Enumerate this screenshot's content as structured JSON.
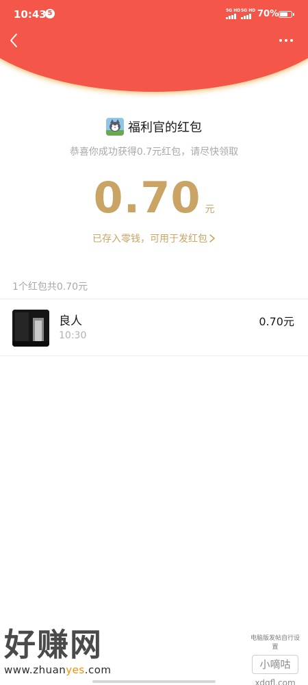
{
  "status_bar": {
    "time": "10:43",
    "app_badge": "5",
    "network_1": "5G HD",
    "network_2": "5G HD",
    "battery_text": "70%",
    "battery_level": 0.7
  },
  "nav": {
    "back_icon": "chevron-left-icon",
    "more_icon": "more-dots-icon"
  },
  "sender": {
    "name": "福利官的红包",
    "avatar_icon": "cartoon-cat-avatar"
  },
  "subtitle": "恭喜你成功获得0.7元红包，请尽快领取",
  "amount": {
    "value": "0.70",
    "unit": "元"
  },
  "saved_link": "已存入零钱，可用于发红包",
  "summary": "1个红包共0.70元",
  "records": [
    {
      "name": "良人",
      "time": "10:30",
      "amount": "0.70元"
    }
  ],
  "watermark_left": {
    "title": "好赚网",
    "url_prefix": "www.zhuan",
    "url_highlight": "yes",
    "url_suffix": ".com"
  },
  "watermark_right": {
    "top_text": "电脑版发帖自行设置",
    "box_text": "小嘀咕",
    "url": "xdgfl.com"
  },
  "colors": {
    "header_red": "#f4564a",
    "gold": "#c9a464",
    "muted_gray": "#a8a8a8"
  }
}
